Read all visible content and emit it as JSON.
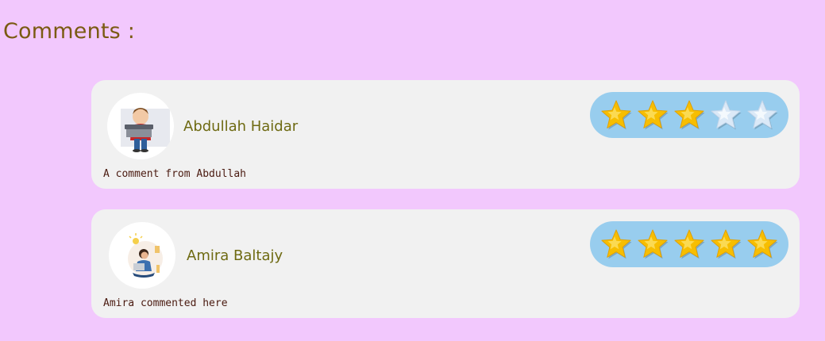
{
  "section_title": "Comments :",
  "colors": {
    "page_background": "#f2c8fd",
    "card_background": "#f1f1f1",
    "rating_pill": "#98cdee",
    "star_filled": "#f7be00",
    "star_empty": "#dbe9f7",
    "title_color": "#7a5a12",
    "name_color": "#6e6a12",
    "comment_color": "#4a1a10"
  },
  "comments": [
    {
      "author": "Abdullah Haidar",
      "avatar_icon": "man-holding-laptop-avatar",
      "text": "A comment from Abdullah",
      "rating": 3,
      "max_rating": 5
    },
    {
      "author": "Amira Baltajy",
      "avatar_icon": "woman-with-laptop-ideas-avatar",
      "text": "Amira commented here",
      "rating": 5,
      "max_rating": 5
    }
  ]
}
